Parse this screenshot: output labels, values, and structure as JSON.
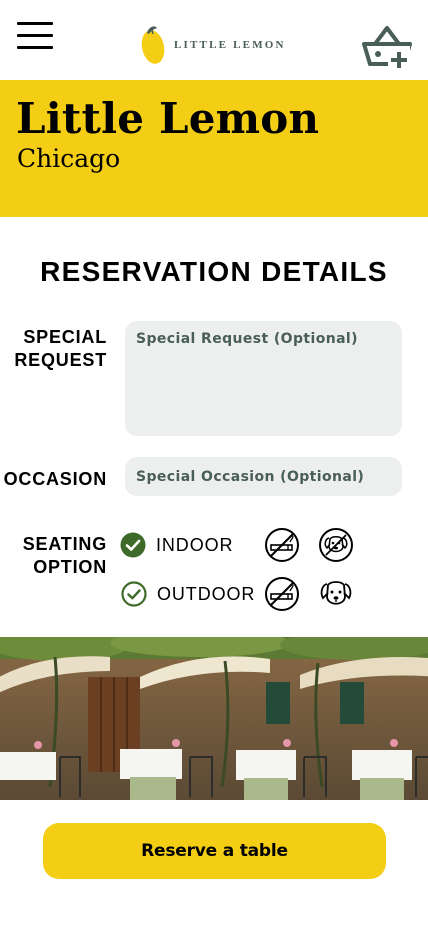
{
  "header": {
    "logo_text": "LITTLE LEMON",
    "menu_icon": "hamburger-menu-icon",
    "basket_icon": "basket-add-icon"
  },
  "hero": {
    "title": "Little Lemon",
    "subtitle": "Chicago"
  },
  "form": {
    "title": "RESERVATION DETAILS",
    "special_request": {
      "label_line1": "SPECIAL",
      "label_line2": "REQUEST",
      "placeholder": "Special Request (Optional)"
    },
    "occasion": {
      "label": "OCCASION",
      "placeholder": "Special Occasion (Optional)"
    },
    "seating": {
      "label_line1": "SEATING",
      "label_line2": "OPTION",
      "options": [
        {
          "label": "INDOOR",
          "selected": true
        },
        {
          "label": "OUTDOOR",
          "selected": false
        }
      ],
      "amenity_icons": [
        "no-smoking-icon",
        "dog-icon",
        "no-smoking-icon",
        "dog-icon"
      ]
    }
  },
  "reserve_button": "Reserve a table",
  "colors": {
    "primary_yellow": "#f4ce14",
    "primary_green": "#495e57",
    "check_green": "#3f6b2a",
    "field_bg": "#edefee"
  }
}
